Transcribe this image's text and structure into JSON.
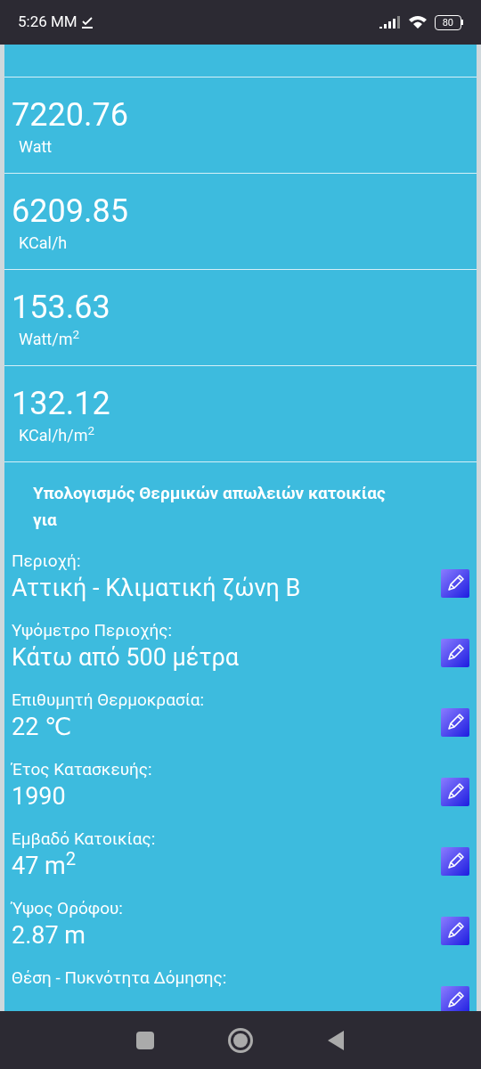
{
  "status_bar": {
    "time": "5:26 MM",
    "battery": "80"
  },
  "results": [
    {
      "value": "7220.76",
      "unit": "Watt"
    },
    {
      "value": "6209.85",
      "unit": "KCal/h"
    },
    {
      "value": "153.63",
      "unit": "Watt/m$^{2}$"
    },
    {
      "value": "132.12",
      "unit": "KCal/h/m$^{2}$"
    }
  ],
  "section_heading": "Υπολογισμός Θερμικών απωλειών κατοικίας για",
  "fields": [
    {
      "label": "Περιοχή:",
      "value": "Αττική - Κλιματική ζώνη Β"
    },
    {
      "label": "Υψόμετρο Περιοχής:",
      "value": "Κάτω από 500 μέτρα"
    },
    {
      "label": "Επιθυμητή Θερμοκρασία:",
      "value": "22 ℃"
    },
    {
      "label": "Έτος Κατασκευής:",
      "value": "1990"
    },
    {
      "label": "Εμβαδό Κατοικίας:",
      "value": "47 m$^{2}$"
    },
    {
      "label": "Ύψος Ορόφου:",
      "value": "2.87 m"
    },
    {
      "label": "Θέση - Πυκνότητα Δόμησης:"
    }
  ]
}
